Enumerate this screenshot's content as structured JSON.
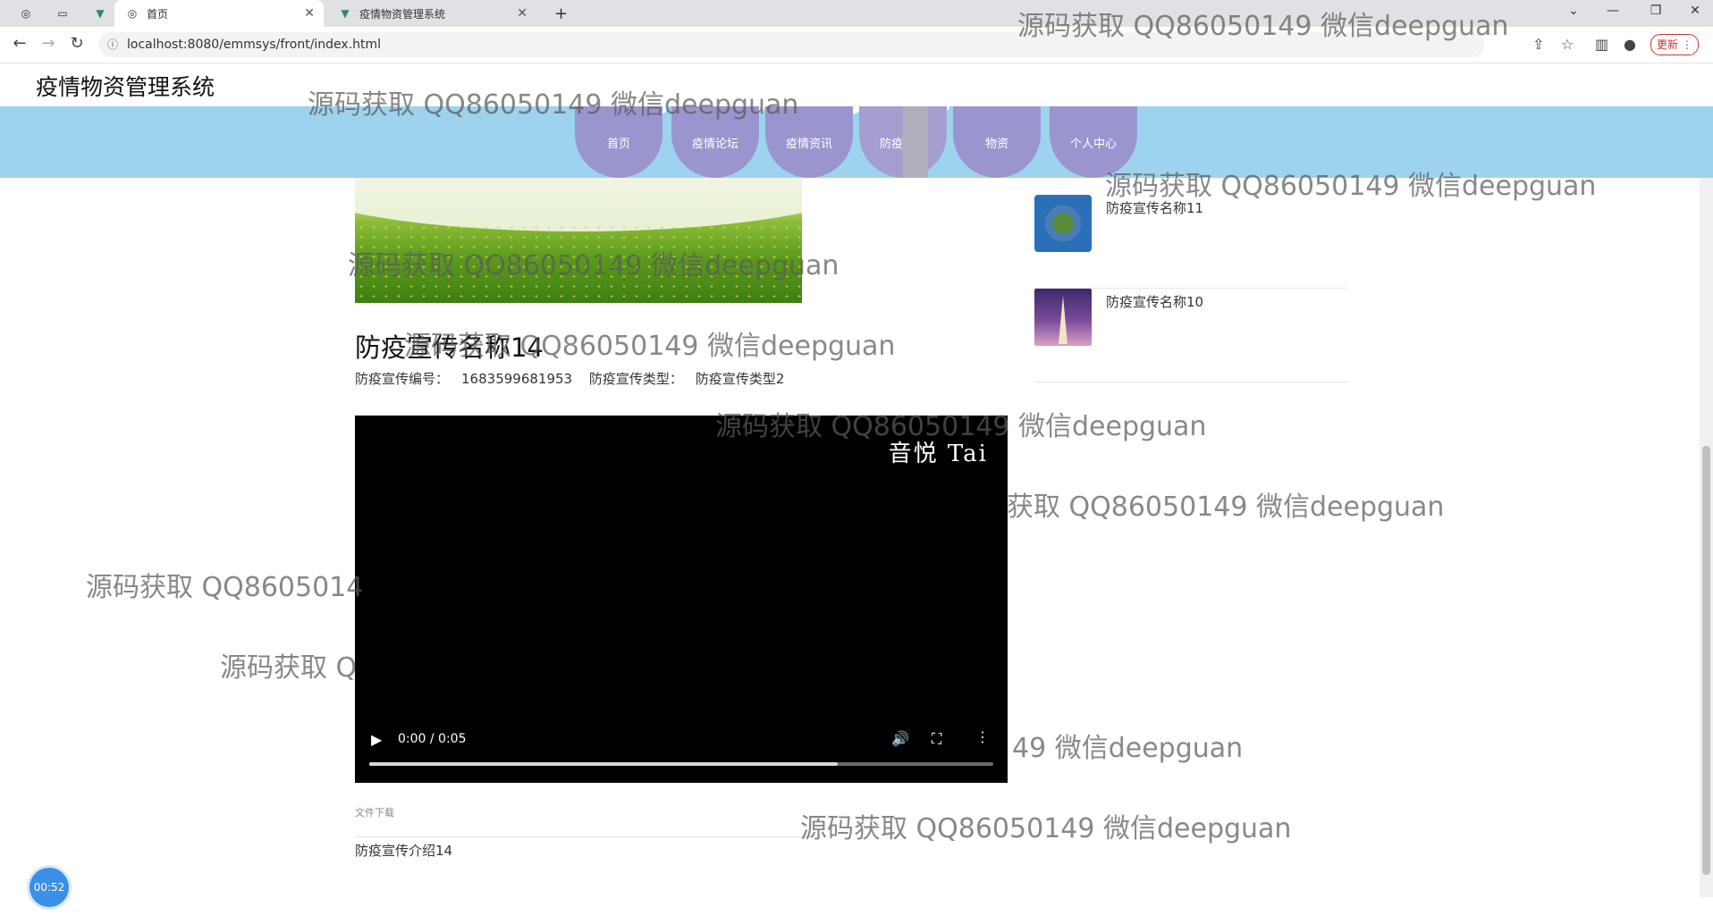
{
  "browser": {
    "tabs": [
      {
        "label": "首页",
        "active": true
      },
      {
        "label": "疫情物资管理系统",
        "active": false
      }
    ],
    "new_tab_symbol": "+",
    "url": "localhost:8080/emmsys/front/index.html",
    "update_label": "更新"
  },
  "site": {
    "title": "疫情物资管理系统",
    "nav": [
      {
        "label": "首页"
      },
      {
        "label": "疫情论坛"
      },
      {
        "label": "疫情资讯"
      },
      {
        "label": "防疫宣传",
        "active": true
      },
      {
        "label": "物资"
      },
      {
        "label": "个人中心"
      }
    ]
  },
  "article": {
    "title": "防疫宣传名称14",
    "meta_number_label": "防疫宣传编号：",
    "meta_number_value": "1683599681953",
    "meta_type_label": "防疫宣传类型：",
    "meta_type_value": "防疫宣传类型2",
    "video": {
      "brand_text": "音悦 Tai",
      "time": "0:00 / 0:05",
      "buffered_fraction": 0.75
    },
    "download_label": "文件下载",
    "intro": "防疫宣传介绍14"
  },
  "sidebar": {
    "items": [
      {
        "name": "防疫宣传名称11"
      },
      {
        "name": "防疫宣传名称10"
      }
    ]
  },
  "recording_timer": "00:52",
  "watermark_text": "源码获取 QQ86050149 微信deepguan",
  "watermark_fragments": {
    "a": "源码获取 QQ8605014",
    "b": "源码获取 Q",
    "c": "获取 QQ86050149 微信deepguan",
    "d": "49 微信deepguan",
    "e": "源码获取 QQ86050149 微信deepguan"
  }
}
